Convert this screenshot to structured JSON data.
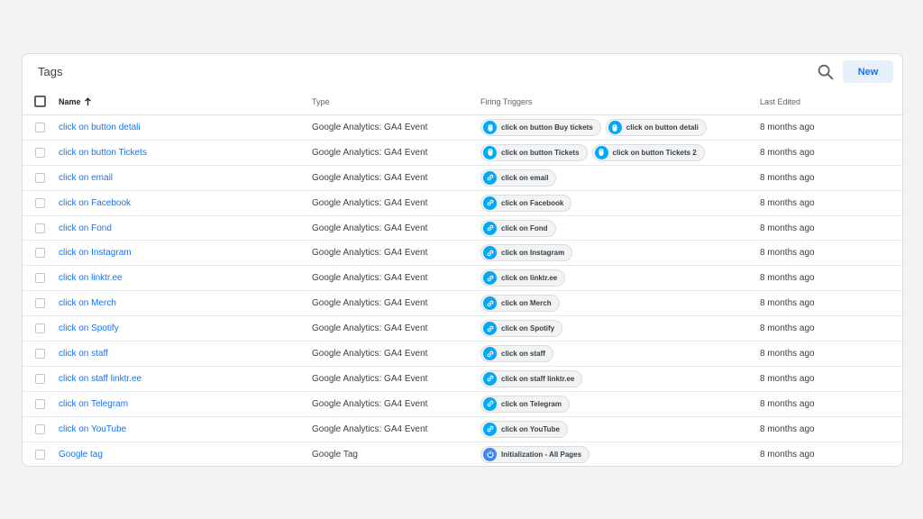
{
  "card": {
    "title": "Tags",
    "new_label": "New"
  },
  "columns": {
    "name": "Name",
    "type": "Type",
    "triggers": "Firing Triggers",
    "edited": "Last Edited"
  },
  "rows": [
    {
      "name": "click on button detali",
      "type": "Google Analytics: GA4 Event",
      "edited": "8 months ago",
      "triggers": [
        {
          "label": "click on button Buy tickets",
          "icon": "mouse-icon"
        },
        {
          "label": "click on button detali",
          "icon": "mouse-icon"
        }
      ]
    },
    {
      "name": "click on button Tickets",
      "type": "Google Analytics: GA4 Event",
      "edited": "8 months ago",
      "triggers": [
        {
          "label": "click on button Tickets",
          "icon": "mouse-icon"
        },
        {
          "label": "click on button Tickets 2",
          "icon": "mouse-icon"
        }
      ]
    },
    {
      "name": "click on email",
      "type": "Google Analytics: GA4 Event",
      "edited": "8 months ago",
      "triggers": [
        {
          "label": "click on email",
          "icon": "link-icon"
        }
      ]
    },
    {
      "name": "click on Facebook",
      "type": "Google Analytics: GA4 Event",
      "edited": "8 months ago",
      "triggers": [
        {
          "label": "click on Facebook",
          "icon": "link-icon"
        }
      ]
    },
    {
      "name": "click on Fond",
      "type": "Google Analytics: GA4 Event",
      "edited": "8 months ago",
      "triggers": [
        {
          "label": "click on Fond",
          "icon": "link-icon"
        }
      ]
    },
    {
      "name": "click on Instagram",
      "type": "Google Analytics: GA4 Event",
      "edited": "8 months ago",
      "triggers": [
        {
          "label": "click on Instagram",
          "icon": "link-icon"
        }
      ]
    },
    {
      "name": "click on linktr.ee",
      "type": "Google Analytics: GA4 Event",
      "edited": "8 months ago",
      "triggers": [
        {
          "label": "click on linktr.ee",
          "icon": "link-icon"
        }
      ]
    },
    {
      "name": "click on Merch",
      "type": "Google Analytics: GA4 Event",
      "edited": "8 months ago",
      "triggers": [
        {
          "label": "click on Merch",
          "icon": "link-icon"
        }
      ]
    },
    {
      "name": "click on Spotify",
      "type": "Google Analytics: GA4 Event",
      "edited": "8 months ago",
      "triggers": [
        {
          "label": "click on Spotify",
          "icon": "link-icon"
        }
      ]
    },
    {
      "name": "click on staff",
      "type": "Google Analytics: GA4 Event",
      "edited": "8 months ago",
      "triggers": [
        {
          "label": "click on staff",
          "icon": "link-icon"
        }
      ]
    },
    {
      "name": "click on staff linktr.ee",
      "type": "Google Analytics: GA4 Event",
      "edited": "8 months ago",
      "triggers": [
        {
          "label": "click on staff linktr.ee",
          "icon": "link-icon"
        }
      ]
    },
    {
      "name": "click on Telegram",
      "type": "Google Analytics: GA4 Event",
      "edited": "8 months ago",
      "triggers": [
        {
          "label": "click on Telegram",
          "icon": "link-icon"
        }
      ]
    },
    {
      "name": "click on YouTube",
      "type": "Google Analytics: GA4 Event",
      "edited": "8 months ago",
      "triggers": [
        {
          "label": "click on YouTube",
          "icon": "link-icon"
        }
      ]
    },
    {
      "name": "Google tag",
      "type": "Google Tag",
      "edited": "8 months ago",
      "triggers": [
        {
          "label": "Initialization - All Pages",
          "icon": "power-icon"
        }
      ]
    }
  ],
  "colors": {
    "link": "#1a73e8",
    "trigger_icon": "#03a9f4",
    "init_icon": "#4285f4",
    "new_button_bg": "#e8f0fe"
  }
}
